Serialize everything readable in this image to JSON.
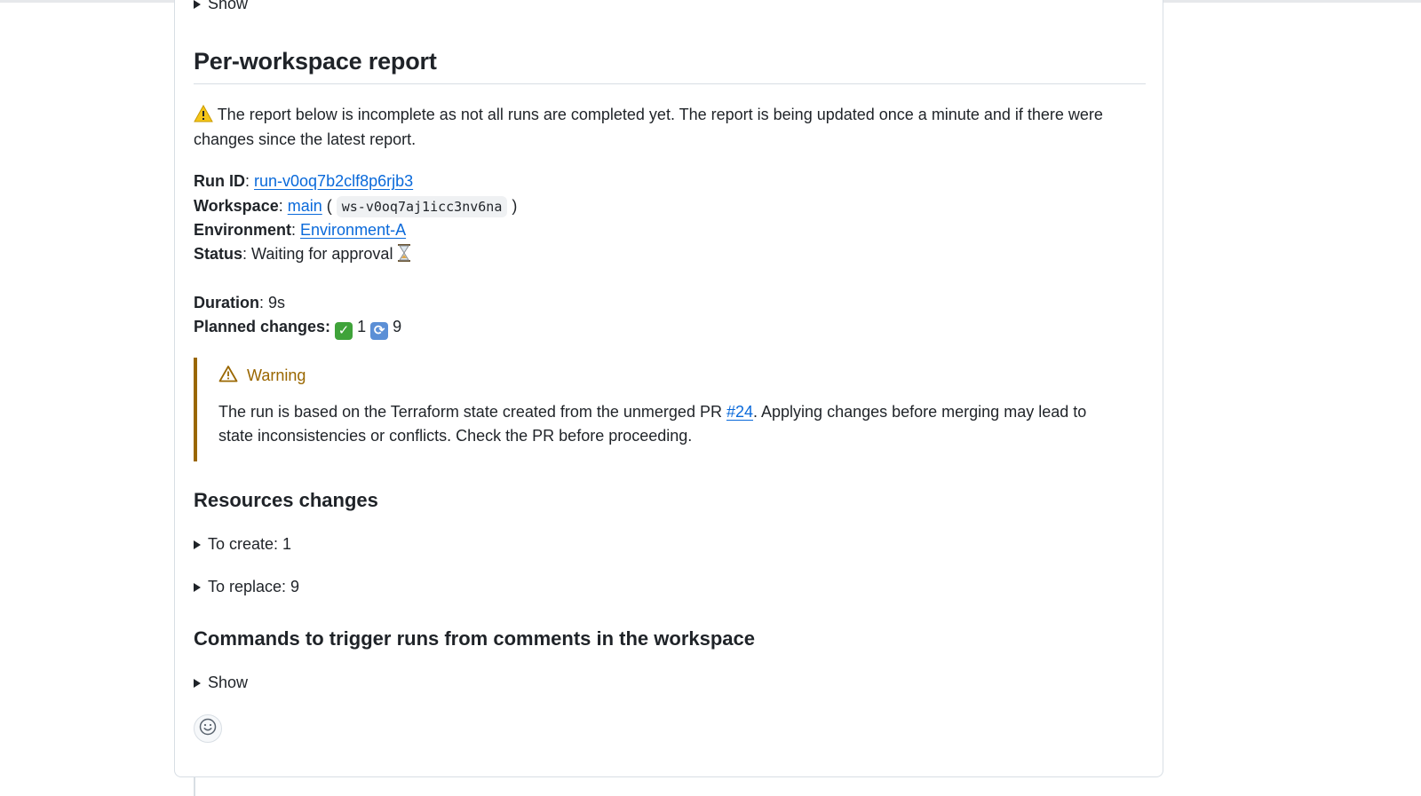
{
  "top_details": {
    "label": "Show"
  },
  "report": {
    "title": "Per-workspace report",
    "notice_icon": "warning-emoji",
    "notice": "The report below is incomplete as not all runs are completed yet. The report is being updated once a minute and if there were changes since the latest report.",
    "run_id_label": "Run ID",
    "run_id": "run-v0oq7b2clf8p6rjb3",
    "workspace_label": "Workspace",
    "workspace_name": "main",
    "workspace_id": "ws-v0oq7aj1icc3nv6na",
    "environment_label": "Environment",
    "environment": "Environment-A",
    "status_label": "Status",
    "status": "Waiting for approval",
    "status_icon": "hourglass-emoji",
    "duration_label": "Duration",
    "duration": "9s",
    "planned_label": "Planned changes:",
    "planned_create_count": "1",
    "planned_replace_count": "9"
  },
  "warning": {
    "title": "Warning",
    "text_before": "The run is based on the Terraform state created from the unmerged PR ",
    "pr_link": "#24",
    "text_after": ". Applying changes before merging may lead to state inconsistencies or conflicts. Check the PR before proceeding.",
    "color": "#9a6700"
  },
  "resources": {
    "title": "Resources changes",
    "to_create": "To create: 1",
    "to_replace": "To replace: 9"
  },
  "commands": {
    "title": "Commands to trigger runs from comments in the workspace",
    "show_label": "Show"
  },
  "colors": {
    "link": "#0969da",
    "border": "#d8dee4",
    "text": "#1f2328"
  }
}
